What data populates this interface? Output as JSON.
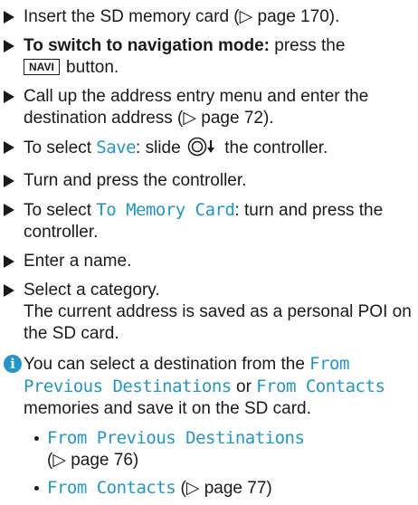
{
  "steps": {
    "s1_pre": "Insert the SD memory card (",
    "s1_ref": "▷ page 170",
    "s1_post": ").",
    "s2_bold": "To switch to navigation mode:",
    "s2_mid": " press the",
    "s2_key": "NAVI",
    "s2_post": " button.",
    "s3_pre": "Call up the address entry menu and enter the destination address (",
    "s3_ref": "▷ page 72",
    "s3_post": ").",
    "s4_pre": "To select ",
    "s4_disp": "Save",
    "s4_mid": ": slide ",
    "s4_post": " the controller.",
    "s5": "Turn and press the controller.",
    "s6_pre": "To select ",
    "s6_disp": "To Memory Card",
    "s6_post": ": turn and press the controller.",
    "s7": "Enter a name.",
    "s8_line1": "Select a category.",
    "s8_line2": "The current address is saved as a personal POI on the SD card."
  },
  "note": {
    "icon": "i",
    "pre": "You can select a destination from the ",
    "disp1": "From Previous Destinations",
    "mid": " or ",
    "disp2": "From Contacts",
    "post": " memories and save it on the SD card.",
    "items": [
      {
        "disp": "From Previous Destinations",
        "ref": "(▷ page 76)"
      },
      {
        "disp": "From Contacts",
        "ref": "(▷ page 77)"
      }
    ]
  },
  "colors": {
    "accent": "#2196c9",
    "text": "#1a1a1a"
  }
}
